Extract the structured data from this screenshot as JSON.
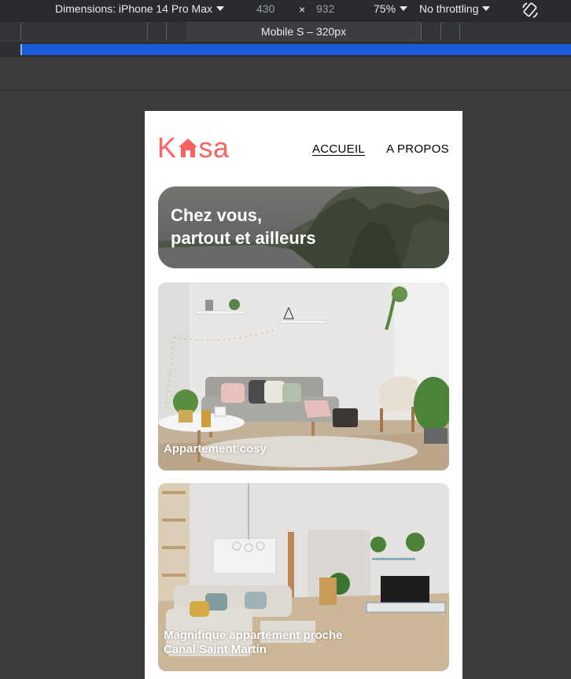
{
  "devtools": {
    "device_label": "Dimensions: iPhone 14 Pro Max",
    "width": "430",
    "times": "×",
    "height": "932",
    "zoom": "75%",
    "throttling": "No throttling",
    "media_query_label": "Mobile S – 320px"
  },
  "site": {
    "logo": {
      "left": "K",
      "right": "sa",
      "accent_color": "#ff6060"
    },
    "nav": [
      {
        "label": "ACCUEIL",
        "active": true
      },
      {
        "label": "A PROPOS",
        "active": false
      }
    ],
    "banner": {
      "line1": "Chez vous,",
      "line2": "partout et ailleurs"
    },
    "listings": [
      {
        "title": "Appartement cosy"
      },
      {
        "title_line1": "Magnifique appartement proche",
        "title_line2": "Canal Saint Martin"
      }
    ]
  }
}
